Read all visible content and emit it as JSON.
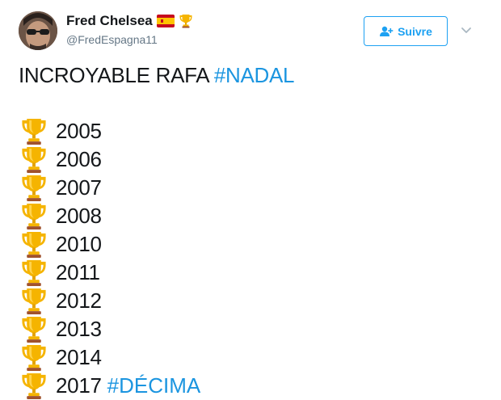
{
  "author": {
    "display_name": "Fred Chelsea",
    "handle": "@FredEspagna11",
    "badges": [
      "spain-flag-icon",
      "trophy-icon"
    ]
  },
  "follow_button": {
    "label": "Suivre",
    "icon": "add-user-icon"
  },
  "menu": {
    "icon": "chevron-down-icon"
  },
  "tweet": {
    "headline_text": "INCROYABLE RAFA",
    "headline_hashtag": "#NADAL",
    "trophy_years": [
      {
        "year": "2005",
        "icon": "trophy-icon"
      },
      {
        "year": "2006",
        "icon": "trophy-icon"
      },
      {
        "year": "2007",
        "icon": "trophy-icon"
      },
      {
        "year": "2008",
        "icon": "trophy-icon"
      },
      {
        "year": "2010",
        "icon": "trophy-icon"
      },
      {
        "year": "2011",
        "icon": "trophy-icon"
      },
      {
        "year": "2012",
        "icon": "trophy-icon"
      },
      {
        "year": "2013",
        "icon": "trophy-icon"
      },
      {
        "year": "2014",
        "icon": "trophy-icon"
      },
      {
        "year": "2017",
        "icon": "trophy-icon",
        "hashtag": "#DÉCIMA"
      }
    ]
  },
  "colors": {
    "link": "#1b95e0",
    "follow_accent": "#1da1f2",
    "text": "#14171a",
    "secondary_text": "#657786",
    "trophy_gold": "#f5b400",
    "trophy_base": "#a0522d"
  }
}
